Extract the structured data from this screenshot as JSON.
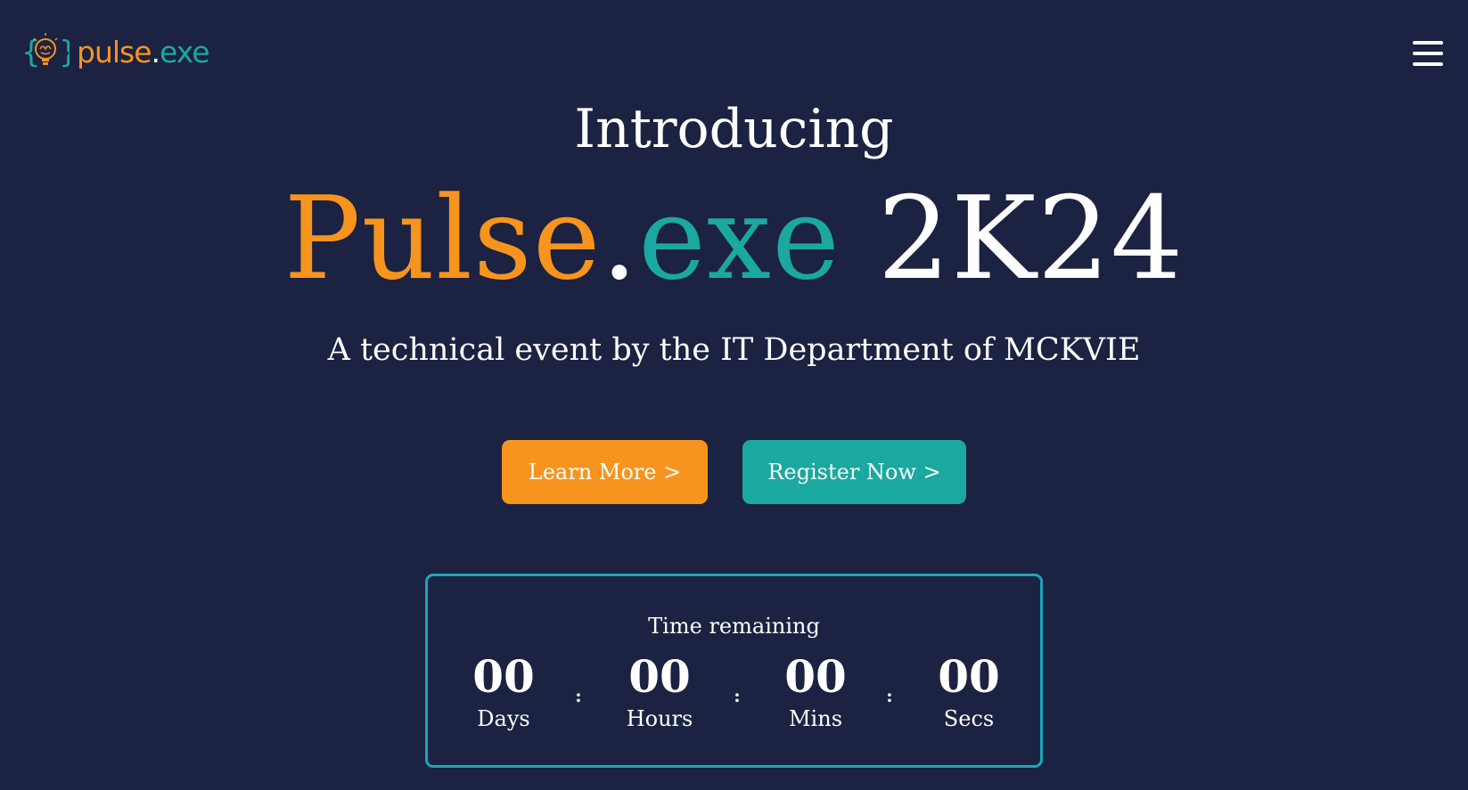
{
  "nav": {
    "logo_text_orange": "pulse",
    "logo_text_dot": ".",
    "logo_text_teal": "exe",
    "logo_icon": "lightbulb-brain-icon",
    "menu_icon": "hamburger-menu-icon"
  },
  "hero": {
    "intro": "Introducing",
    "title_part1": "Pulse",
    "title_dot": ".",
    "title_part2": "exe",
    "title_part3": "2K24",
    "subtitle": "A technical event by the IT Department of MCKVIE"
  },
  "buttons": {
    "learn_more": "Learn More >",
    "register_now": "Register Now >"
  },
  "countdown": {
    "label": "Time remaining",
    "separator": ":",
    "units": [
      {
        "value": "00",
        "name": "Days"
      },
      {
        "value": "00",
        "name": "Hours"
      },
      {
        "value": "00",
        "name": "Mins"
      },
      {
        "value": "00",
        "name": "Secs"
      }
    ]
  },
  "colors": {
    "background": "#1c2241",
    "orange": "#f7941d",
    "teal": "#1aa8a0",
    "countdown_border": "#1aa8b8"
  }
}
